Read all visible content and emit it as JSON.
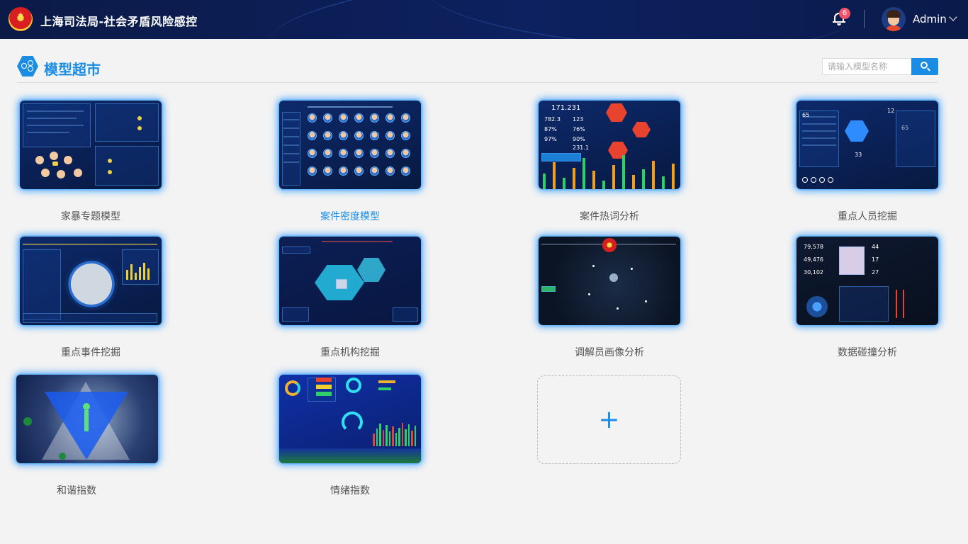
{
  "header": {
    "app_title": "上海司法局-社会矛盾风险感控",
    "notification_count": "6",
    "user_name": "Admin"
  },
  "section": {
    "title": "模型超市",
    "search_placeholder": "请输入模型名称"
  },
  "models": [
    {
      "label": "家暴专题模型"
    },
    {
      "label": "案件密度模型"
    },
    {
      "label": "案件热词分析"
    },
    {
      "label": "重点人员挖掘"
    },
    {
      "label": "重点事件挖掘"
    },
    {
      "label": "重点机构挖掘"
    },
    {
      "label": "调解员画像分析"
    },
    {
      "label": "数据碰撞分析"
    },
    {
      "label": "和谐指数"
    },
    {
      "label": "情绪指数"
    }
  ],
  "thumbnails": {
    "hot_word": {
      "big": "171.231",
      "v1": "782.3",
      "v2": "123",
      "v3": "87%",
      "v4": "76%",
      "v5": "97%",
      "v6": "90%",
      "v7": "231.1"
    },
    "person": {
      "v1": "12",
      "v2": "65",
      "v3": "33",
      "v4": "65"
    },
    "collision": {
      "v1": "79,578",
      "v2": "49,476",
      "v3": "30,102",
      "v4": "44",
      "v5": "17",
      "v6": "27"
    }
  },
  "add_card": {
    "symbol": "+"
  },
  "colors": {
    "accent": "#1b8ce4",
    "header_bg": "#0b1a47",
    "badge": "#f0566b"
  }
}
